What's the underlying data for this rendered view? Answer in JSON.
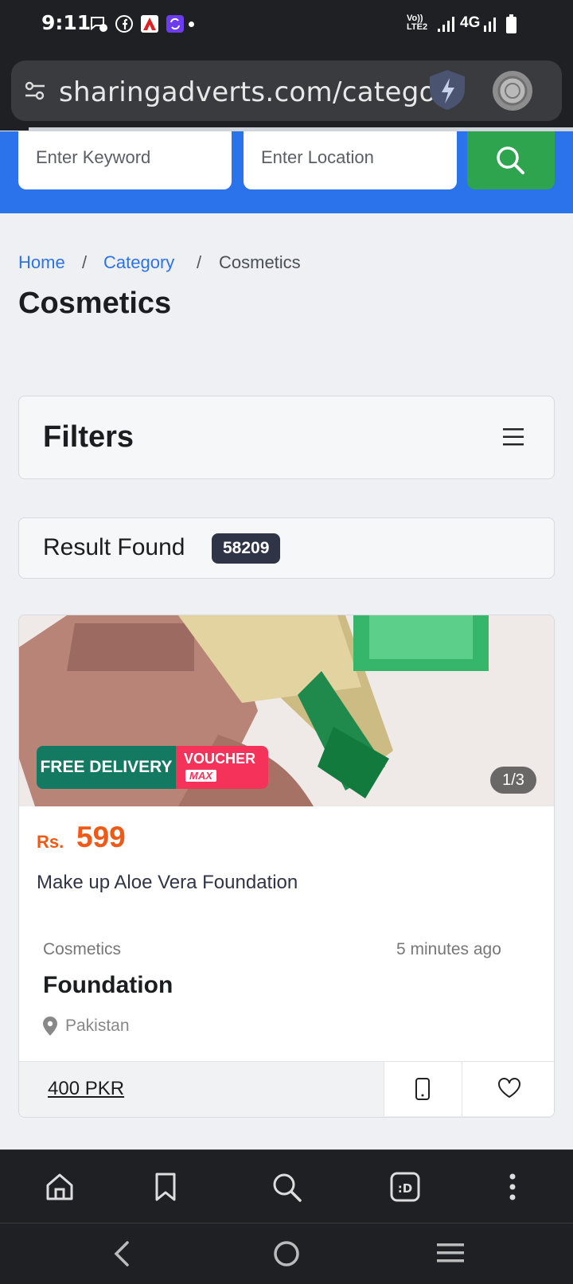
{
  "status_bar": {
    "time": "9:11",
    "network": "4G",
    "volte": "Vo)) LTE2"
  },
  "browser": {
    "url": "sharingadverts.com/category,"
  },
  "search": {
    "keyword_placeholder": "Enter Keyword",
    "location_placeholder": "Enter Location"
  },
  "breadcrumb": {
    "home": "Home",
    "separator": "/",
    "category": "Category",
    "current": "Cosmetics"
  },
  "page_title": "Cosmetics",
  "filters": {
    "title": "Filters"
  },
  "results": {
    "label": "Result Found",
    "count": "58209"
  },
  "listing": {
    "image_counter": "1/3",
    "badge_free_delivery": "FREE DELIVERY",
    "badge_voucher": "VOUCHER",
    "badge_voucher_sub": "MAX",
    "currency": "Rs.",
    "price": "599",
    "title": "Make up Aloe Vera Foundation",
    "category": "Cosmetics",
    "posted": "5 minutes ago",
    "name": "Foundation",
    "location": "Pakistan",
    "ad_price": "400 PKR"
  },
  "colors": {
    "primary_blue": "#2b73ea",
    "search_green": "#2ea44f",
    "price_orange": "#ef5a16",
    "dark_bar": "#1f2023"
  }
}
